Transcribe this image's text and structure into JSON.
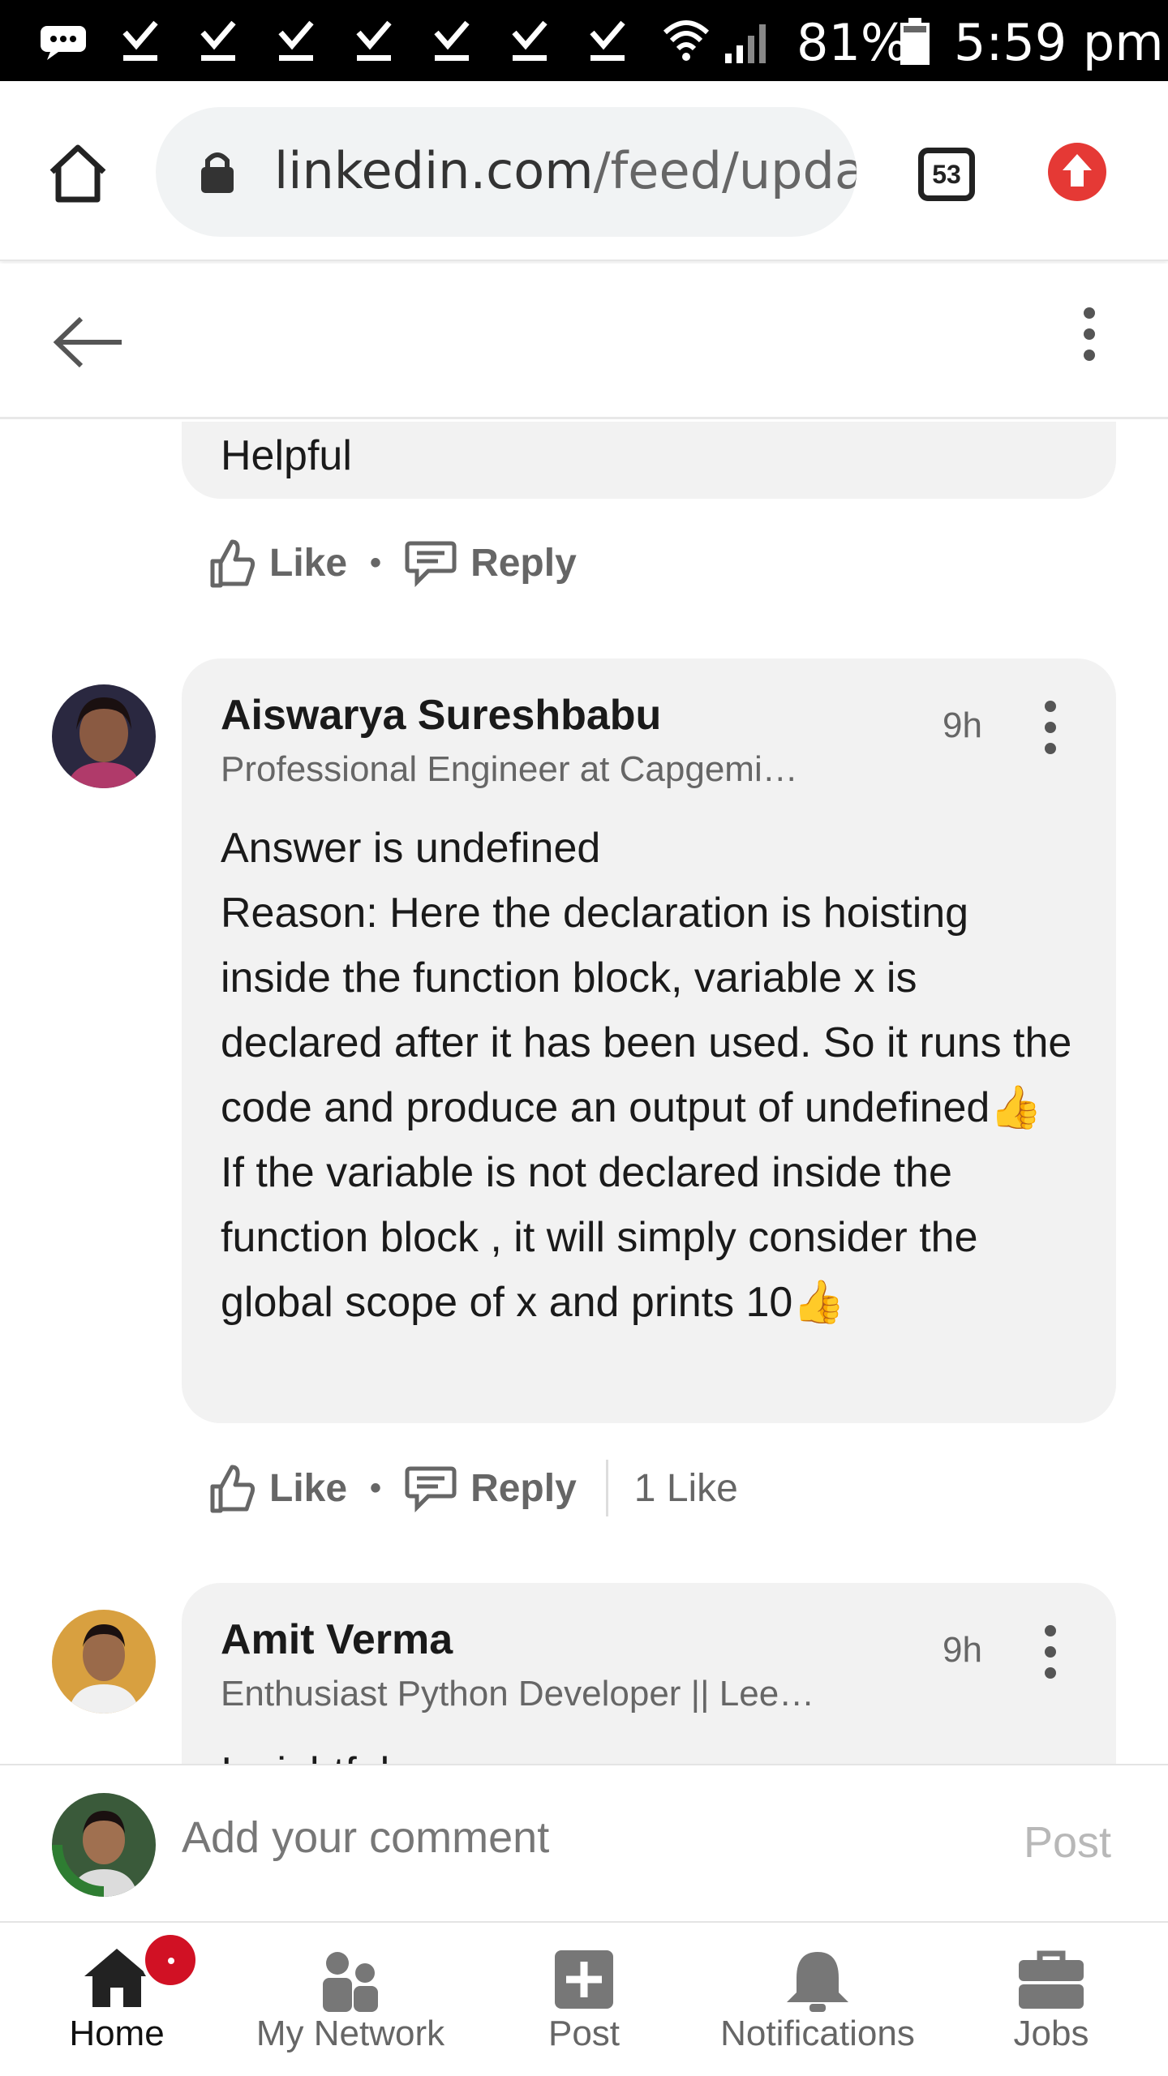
{
  "status_bar": {
    "battery": "81%",
    "time": "5:59 pm"
  },
  "browser": {
    "url_domain": "linkedin.com",
    "url_path": "/feed/upda",
    "tab_count": "53"
  },
  "previous_comment": {
    "text_tail": "Helpful",
    "like_label": "Like",
    "reply_label": "Reply"
  },
  "comments": [
    {
      "author": "Aiswarya Sureshbabu",
      "headline": "Professional Engineer at Capgemi…",
      "time": "9h",
      "lines": [
        "Answer is undefined",
        "Reason: Here the declaration is hoisting inside the function block, variable x is declared after it has been used. So it runs the code and produce an output of undefined👍",
        "If the variable is not declared inside the function block , it will simply consider the global scope of x and prints 10👍"
      ],
      "like_label": "Like",
      "reply_label": "Reply",
      "likes_count": "1 Like"
    },
    {
      "author": "Amit Verma",
      "headline": "Enthusiast Python Developer || Lee…",
      "time": "9h",
      "text_start": "Insightful"
    }
  ],
  "comment_bar": {
    "placeholder": "Add your comment",
    "post_label": "Post"
  },
  "bottom_nav": {
    "items": [
      {
        "label": "Home",
        "icon": "home-icon"
      },
      {
        "label": "My Network",
        "icon": "network-icon"
      },
      {
        "label": "Post",
        "icon": "post-plus-icon"
      },
      {
        "label": "Notifications",
        "icon": "bell-icon"
      },
      {
        "label": "Jobs",
        "icon": "briefcase-icon"
      }
    ]
  },
  "colors": {
    "badge": "#d11124",
    "update_button": "#e53935",
    "bubble": "#f2f2f2"
  }
}
